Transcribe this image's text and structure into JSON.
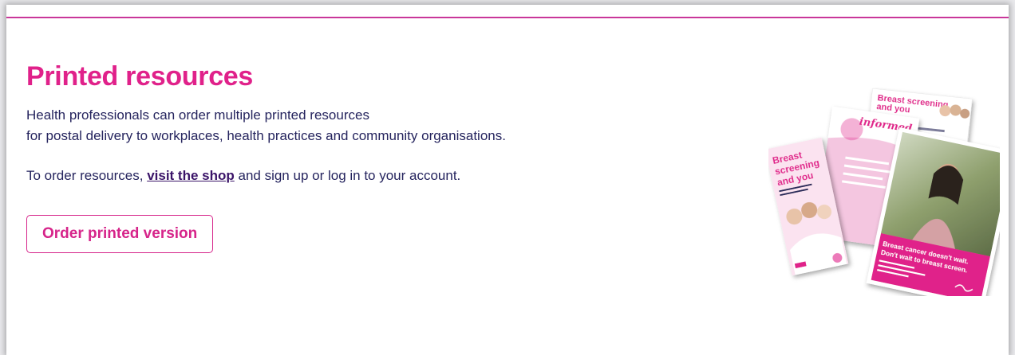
{
  "section": {
    "title": "Printed resources",
    "intro_line1": "Health professionals can order multiple printed resources",
    "intro_line2": "for postal delivery to workplaces, health practices and community organisations.",
    "order_prefix": "To order resources, ",
    "shop_link": "visit the shop",
    "order_suffix": " and sign up or log in to your account.",
    "order_button": "Order printed version"
  },
  "illustration": {
    "brochure_heading_1": "Breast",
    "brochure_heading_2": "screening",
    "brochure_heading_3": "and you",
    "leaflet_heading": "informed",
    "back_sheet_heading": "Breast screening",
    "back_sheet_heading_2": "and you",
    "poster_line1": "Breast cancer doesn't wait.",
    "poster_line2": "Don't wait to breast screen."
  },
  "colors": {
    "accent": "#e0218a",
    "text": "#25245e",
    "link": "#3a1368",
    "rule": "#c9379a"
  }
}
